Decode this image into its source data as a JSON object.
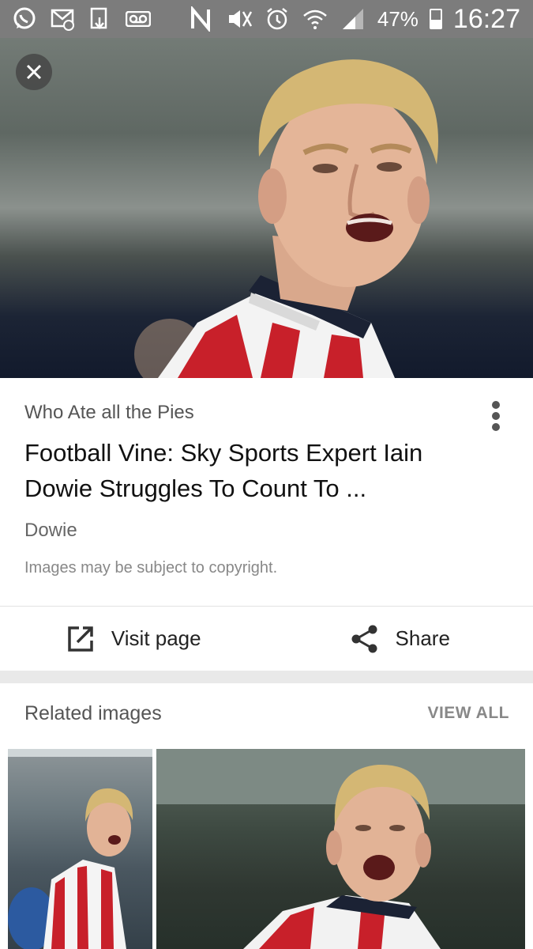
{
  "status_bar": {
    "icons_left": [
      "whatsapp-icon",
      "message-icon",
      "download-icon",
      "voicemail-icon"
    ],
    "icons_right": [
      "nfc-icon",
      "mute-icon",
      "alarm-icon",
      "wifi-icon",
      "signal-icon"
    ],
    "battery_percent": "47%",
    "battery_level": 0.47,
    "time": "16:27"
  },
  "hero": {
    "close_icon": "close-icon"
  },
  "result": {
    "source": "Who Ate all the Pies",
    "title": "Football Vine: Sky Sports Expert Iain Dowie Struggles To Count To ...",
    "tag": "Dowie",
    "copyright": "Images may be subject to copyright.",
    "more_icon": "more-vert-icon"
  },
  "actions": {
    "visit_label": "Visit page",
    "share_label": "Share"
  },
  "related": {
    "title": "Related images",
    "view_all": "VIEW ALL"
  },
  "colors": {
    "status_bar": "#7c7c7c",
    "shirt_red": "#c8202a",
    "hair": "#d4b774"
  }
}
